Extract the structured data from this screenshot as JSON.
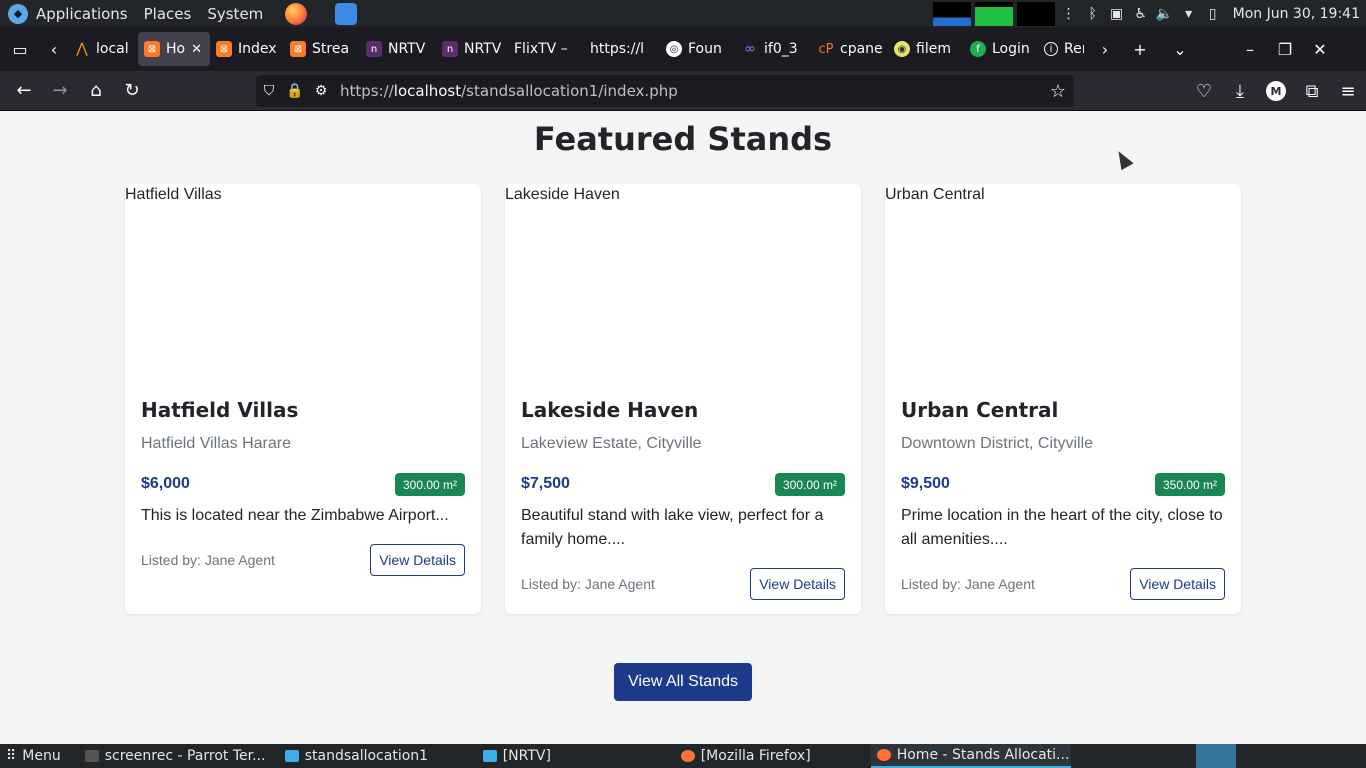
{
  "os_panel": {
    "menus": [
      "Applications",
      "Places",
      "System"
    ],
    "clock": "Mon Jun 30, 19:41"
  },
  "tabs": [
    {
      "label": "local",
      "icon": "ubuntu-icon"
    },
    {
      "label": "Ho",
      "icon": "xampp-icon"
    },
    {
      "label": "Index",
      "icon": "xampp-icon"
    },
    {
      "label": "Strea",
      "icon": "xampp-icon"
    },
    {
      "label": "NRTV",
      "icon": "nrtv-icon"
    },
    {
      "label": "NRTV",
      "icon": "nrtv-icon"
    },
    {
      "label": "FlixTV –",
      "icon": ""
    },
    {
      "label": "https://l",
      "icon": ""
    },
    {
      "label": "Foun",
      "icon": "found-icon"
    },
    {
      "label": "if0_3",
      "icon": "infinity-icon"
    },
    {
      "label": "cpane",
      "icon": "cpanel-icon"
    },
    {
      "label": "filem",
      "icon": "filemanager-icon"
    },
    {
      "label": "Login",
      "icon": "login-icon"
    },
    {
      "label": "Rem",
      "icon": "info-icon"
    }
  ],
  "urlbar": {
    "prefix": "https://",
    "host": "localhost",
    "path": "/standsallocation1/index.php"
  },
  "profile_initial": "M",
  "page": {
    "section_title": "Featured Stands",
    "cards": [
      {
        "image_alt": "Hatfield Villas",
        "title": "Hatfield Villas",
        "location": "Hatfield Villas Harare",
        "price": "$6,000",
        "area": "300.00 m²",
        "description": "This is located near the Zimbabwe Airport...",
        "agent": "Listed by: Jane Agent",
        "button": "View Details"
      },
      {
        "image_alt": "Lakeside Haven",
        "title": "Lakeside Haven",
        "location": "Lakeview Estate, Cityville",
        "price": "$7,500",
        "area": "300.00 m²",
        "description": "Beautiful stand with lake view, perfect for a family home....",
        "agent": "Listed by: Jane Agent",
        "button": "View Details"
      },
      {
        "image_alt": "Urban Central",
        "title": "Urban Central",
        "location": "Downtown District, Cityville",
        "price": "$9,500",
        "area": "350.00 m²",
        "description": "Prime location in the heart of the city, close to all amenities....",
        "agent": "Listed by: Jane Agent",
        "button": "View Details"
      }
    ],
    "view_all": "View All Stands"
  },
  "taskbar": {
    "menu": "Menu",
    "tasks": [
      {
        "label": "screenrec - Parrot Ter...",
        "icon": "terminal-icon"
      },
      {
        "label": "standsallocation1",
        "icon": "folder-icon"
      },
      {
        "label": "[NRTV]",
        "icon": "folder-icon"
      },
      {
        "label": "[Mozilla Firefox]",
        "icon": "firefox-icon"
      },
      {
        "label": "Home - Stands Allocati...",
        "icon": "firefox-icon"
      }
    ]
  },
  "colors": {
    "primary": "#1e3a8a",
    "badge": "#198754",
    "browser_chrome": "#1c1b22"
  }
}
